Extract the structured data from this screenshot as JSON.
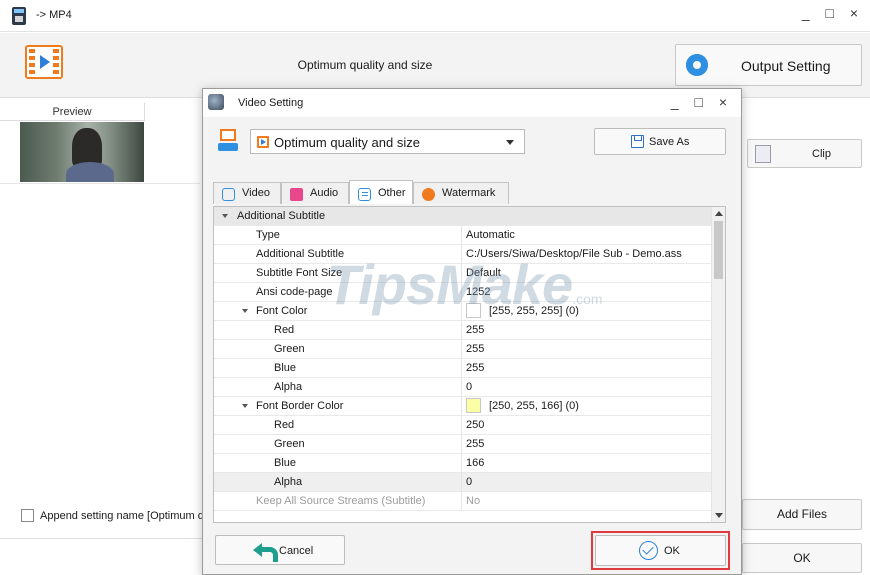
{
  "window": {
    "title": "-> MP4",
    "controls": "_ □ ×"
  },
  "toolbar": {
    "profile_caption": "Optimum quality and size",
    "output_setting_label": "Output Setting"
  },
  "file_list": {
    "preview_header": "Preview",
    "clip_label": "Clip"
  },
  "footer": {
    "append_label": "Append setting name [Optimum qu",
    "add_files_label": "Add Files",
    "ok_label": "OK"
  },
  "dialog": {
    "title": "Video Setting",
    "controls": "_ □ ×",
    "profile_value": "Optimum quality and size",
    "save_as_label": "Save As",
    "tabs": [
      {
        "label": "Video",
        "icon": "video-icon"
      },
      {
        "label": "Audio",
        "icon": "audio-icon"
      },
      {
        "label": "Other",
        "icon": "list-icon",
        "active": true
      },
      {
        "label": "Watermark",
        "icon": "watermark-icon"
      }
    ],
    "grid": {
      "category": "Additional Subtitle",
      "rows": [
        {
          "name": "Type",
          "value": "Automatic"
        },
        {
          "name": "Additional Subtitle",
          "value": "C:/Users/Siwa/Desktop/File Sub - Demo.ass"
        },
        {
          "name": "Subtitle Font Size",
          "value": "Default"
        },
        {
          "name": "Ansi code-page",
          "value": "1252"
        },
        {
          "name": "Font Color",
          "value": "[255, 255, 255] (0)",
          "swatch": "#ffffff"
        },
        {
          "name": "Red",
          "value": "255"
        },
        {
          "name": "Green",
          "value": "255"
        },
        {
          "name": "Blue",
          "value": "255"
        },
        {
          "name": "Alpha",
          "value": "0"
        },
        {
          "name": "Font Border Color",
          "value": "[250, 255, 166] (0)",
          "swatch": "#faffa6"
        },
        {
          "name": "Red",
          "value": "250"
        },
        {
          "name": "Green",
          "value": "255"
        },
        {
          "name": "Blue",
          "value": "166"
        },
        {
          "name": "Alpha",
          "value": "0"
        },
        {
          "name": "Keep All Source Streams (Subtitle)",
          "value": "No"
        }
      ]
    },
    "cancel_label": "Cancel",
    "ok_label": "OK"
  },
  "watermark": {
    "brand": "TipsMake",
    "suffix": ".com"
  },
  "colors": {
    "accent_orange": "#f07b1e",
    "accent_blue": "#2f8fe0",
    "highlight_red": "#e0393e"
  }
}
